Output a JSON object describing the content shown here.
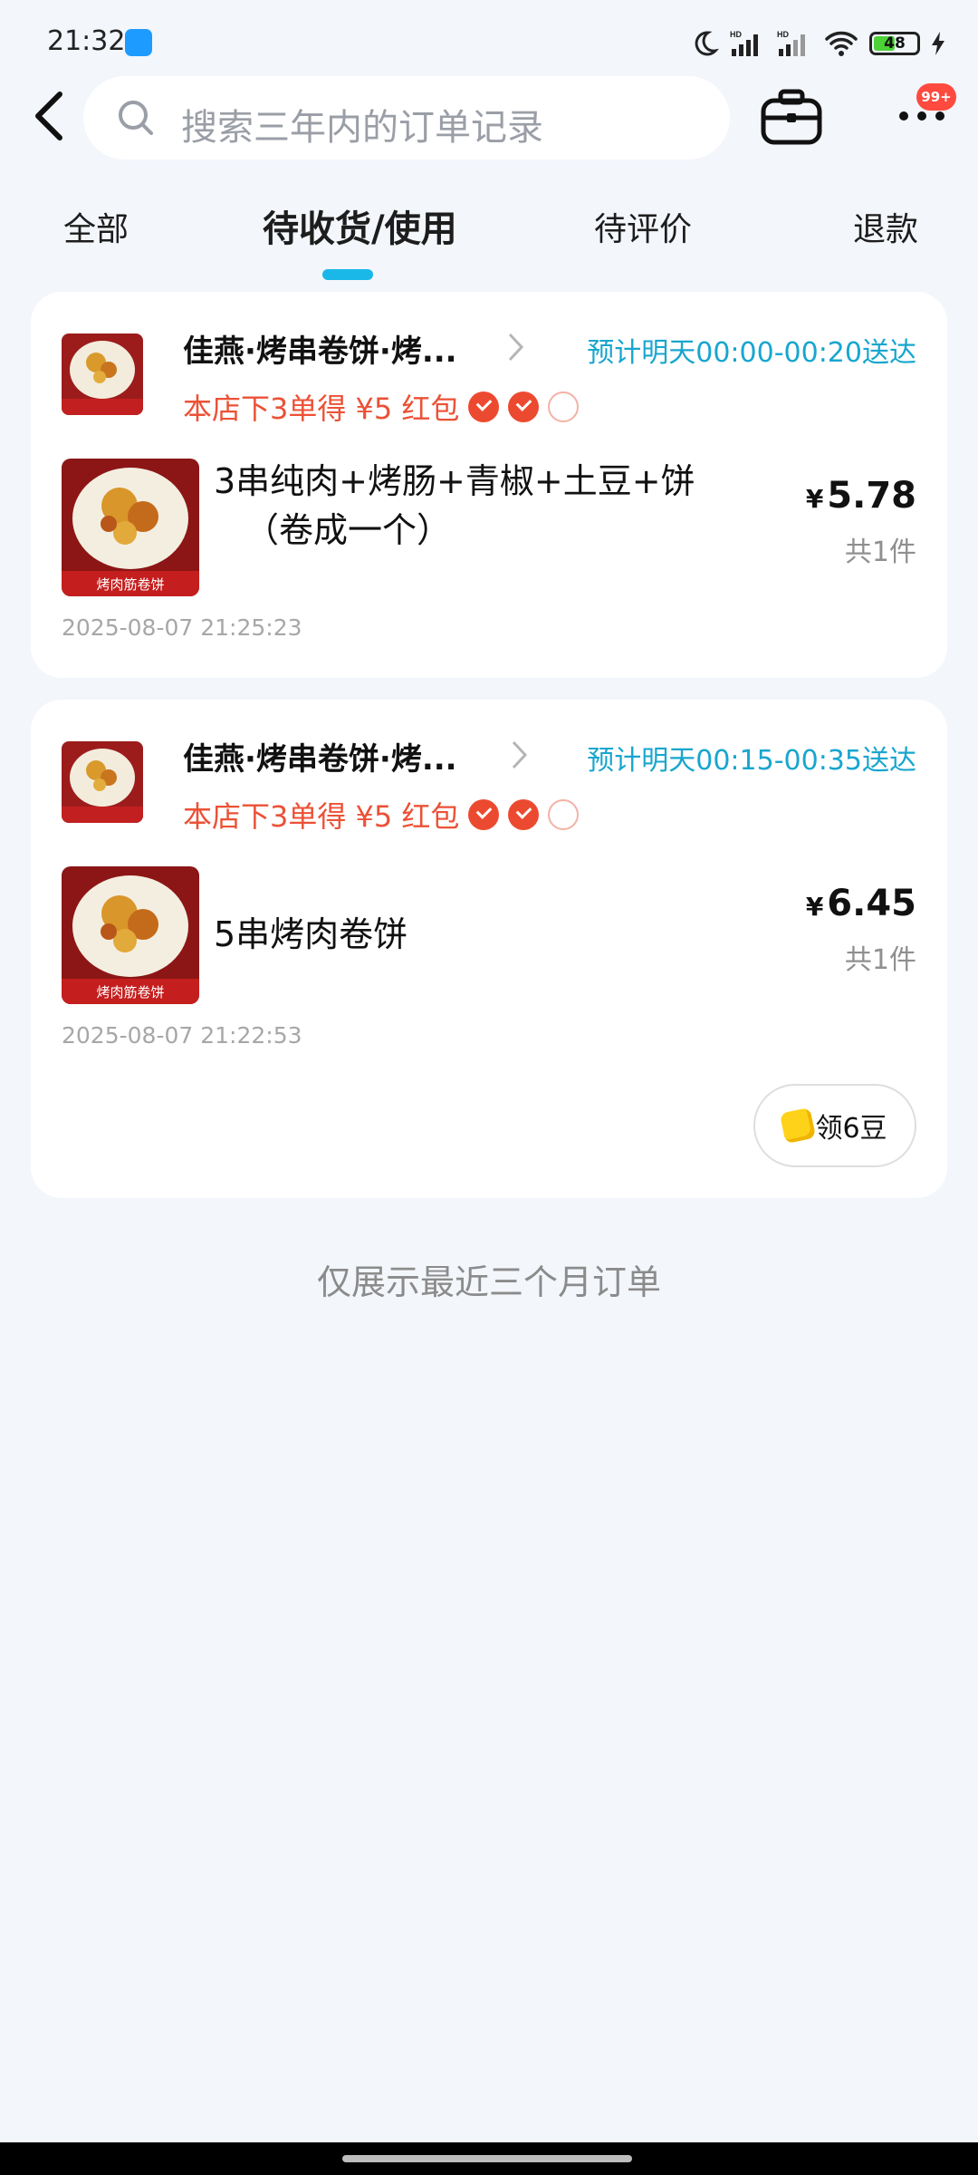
{
  "status_bar": {
    "time": "21:32",
    "battery": "48"
  },
  "search": {
    "placeholder": "搜索三年内的订单记录"
  },
  "header": {
    "badge": "99+"
  },
  "tabs": [
    {
      "label": "全部"
    },
    {
      "label": "待收货/使用"
    },
    {
      "label": "待评价"
    },
    {
      "label": "退款"
    }
  ],
  "orders": [
    {
      "shop_name": "佳燕·烤串卷饼·烤...",
      "eta": "预计明天00:00-00:20送达",
      "promo": "本店下3单得 ¥5 红包",
      "promo_progress": 2,
      "promo_total": 3,
      "item_line1": "3串纯肉+烤肠+青椒+土豆+饼",
      "item_line2": "（卷成一个）",
      "price_symbol": "¥",
      "price": "5.78",
      "qty": "共1件",
      "order_time": "2025-08-07 21:25:23",
      "image_caption": "烤肉筋卷饼"
    },
    {
      "shop_name": "佳燕·烤串卷饼·烤...",
      "eta": "预计明天00:15-00:35送达",
      "promo": "本店下3单得 ¥5 红包",
      "promo_progress": 2,
      "promo_total": 3,
      "item_line1": "5串烤肉卷饼",
      "price_symbol": "¥",
      "price": "6.45",
      "qty": "共1件",
      "order_time": "2025-08-07 21:22:53",
      "image_caption": "烤肉筋卷饼",
      "beans_button": "领6豆"
    }
  ],
  "footer_note": "仅展示最近三个月订单",
  "colors": {
    "accent": "#1ab8e8",
    "promo": "#ec5136",
    "background": "#f3f6fb"
  }
}
